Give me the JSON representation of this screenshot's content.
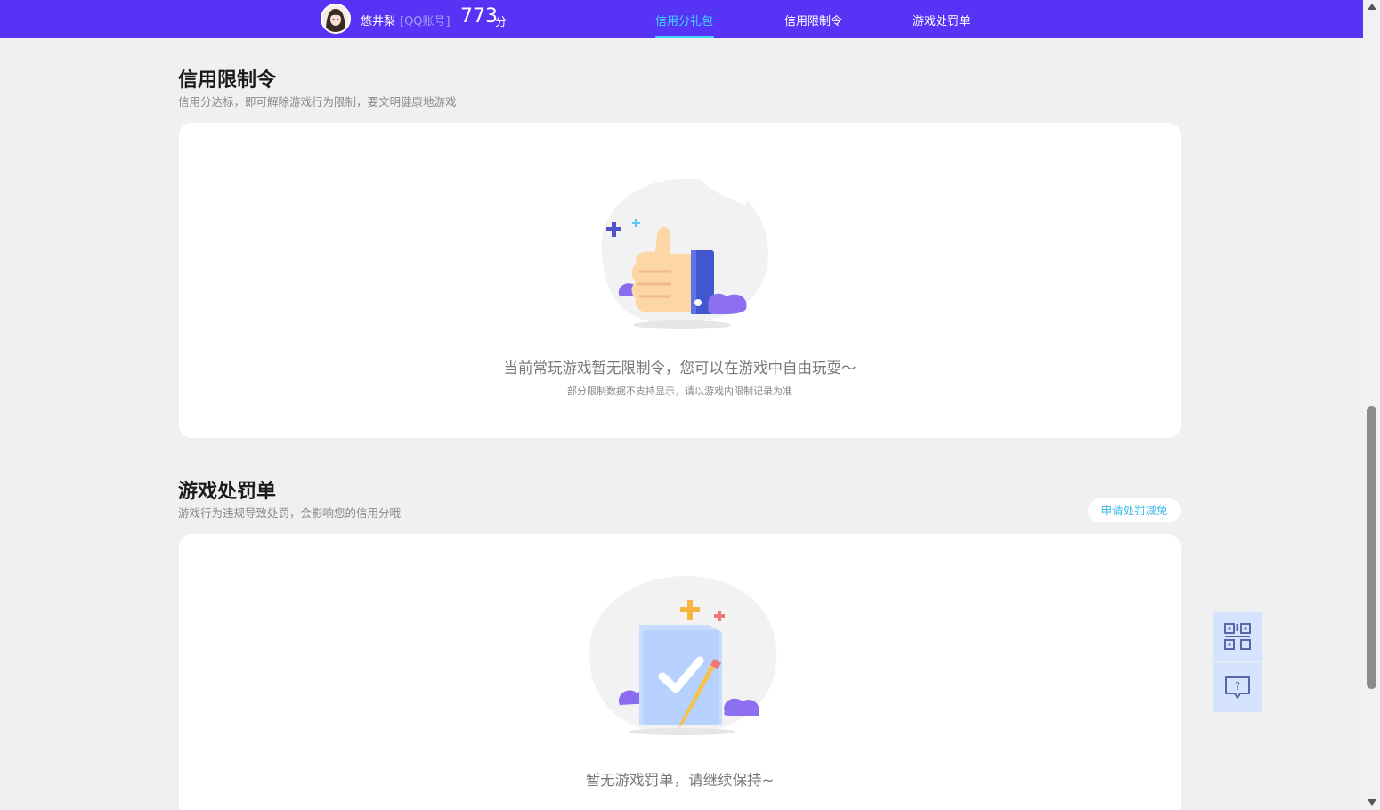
{
  "header": {
    "username": "悠井梨",
    "account_type": "[QQ账号]",
    "score": "773",
    "score_unit": "分",
    "tabs": [
      {
        "label": "信用分礼包",
        "active": true
      },
      {
        "label": "信用限制令",
        "active": false
      },
      {
        "label": "游戏处罚单",
        "active": false
      }
    ]
  },
  "restriction": {
    "title": "信用限制令",
    "subtitle": "信用分达标，即可解除游戏行为限制，要文明健康地游戏",
    "empty_text": "当前常玩游戏暂无限制令，您可以在游戏中自由玩耍～",
    "empty_note": "部分限制数据不支持显示，请以游戏内限制记录为准"
  },
  "penalty": {
    "title": "游戏处罚单",
    "subtitle": "游戏行为违规导致处罚，会影响您的信用分哦",
    "appeal_button": "申请处罚减免",
    "empty_text": "暂无游戏罚单，请继续保持~"
  },
  "side_tools": {
    "icons": [
      "qr-code-icon",
      "help-chat-icon"
    ]
  },
  "colors": {
    "brand": "#5734f5",
    "active_tab": "#3ed8ff",
    "link": "#3ab7e8",
    "page_bg": "#f0f0f0"
  }
}
